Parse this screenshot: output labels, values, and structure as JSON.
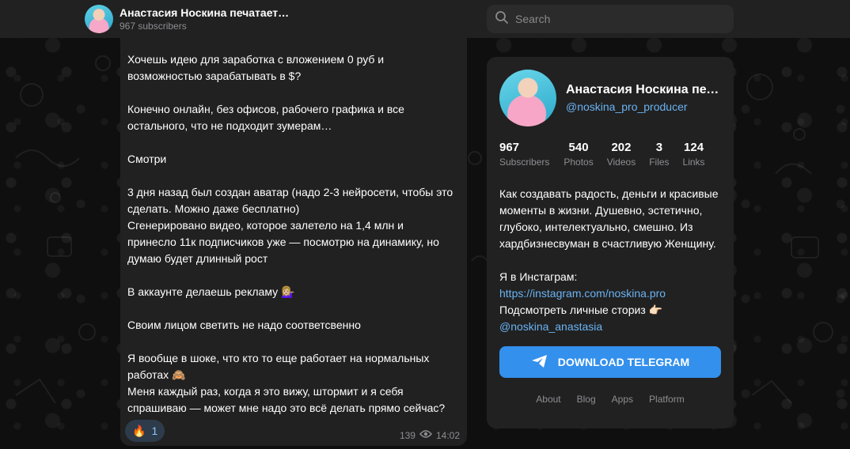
{
  "header": {
    "title": "Анастасия Носкина печатает…",
    "subtitle": "967 subscribers"
  },
  "search": {
    "placeholder": "Search"
  },
  "message": {
    "text": "Хочешь идею для заработка с вложением 0 руб и\nвозможностью зарабатывать в $?\n\nКонечно онлайн, без офисов, рабочего графика и все\nостального, что не подходит зумерам…\n\nСмотри\n\n3 дня назад был создан аватар (надо 2-3 нейросети, чтобы это\nсделать. Можно даже бесплатно)\nСгенерировано видео, которое залетело на 1,4 млн и\nпринесло 11к подписчиков уже — посмотрю на динамику, но\nдумаю будет длинный рост\n\nВ аккаунте делаешь рекламу 💁🏼‍♀️\n\nСвоим лицом светить не надо соответсвенно\n\nЯ вообще в шоке, что кто то еще работает на нормальных\nработах 🙈\nМеня каждый раз, когда я это вижу, штормит и я себя\nспрашиваю — может мне надо это всё делать прямо сейчас?",
    "reaction_emoji": "🔥",
    "reaction_count": "1",
    "views": "139",
    "time": "14:02"
  },
  "profile": {
    "name": "Анастасия Носкина печ…",
    "username": "@noskina_pro_producer",
    "stats": [
      {
        "value": "967",
        "label": "Subscribers"
      },
      {
        "value": "540",
        "label": "Photos"
      },
      {
        "value": "202",
        "label": "Videos"
      },
      {
        "value": "3",
        "label": "Files"
      },
      {
        "value": "124",
        "label": "Links"
      }
    ],
    "description": "Как создавать радость, деньги и красивые моменты в жизни. Душевно, эстетично, глубоко, интелектуально, смешно. Из хардбизнесвуман в счастливую Женщину.",
    "insta_label": "Я в Инстаграм:",
    "insta_link": "https://instagram.com/noskina.pro",
    "stories_label": "Подсмотреть личные сториз 👉🏻",
    "stories_link": "@noskina_anastasia",
    "download_label": "DOWNLOAD TELEGRAM",
    "footer": [
      "About",
      "Blog",
      "Apps",
      "Platform"
    ]
  },
  "colors": {
    "accent": "#3390ec",
    "link": "#6ab3f3",
    "panel": "#212121"
  }
}
